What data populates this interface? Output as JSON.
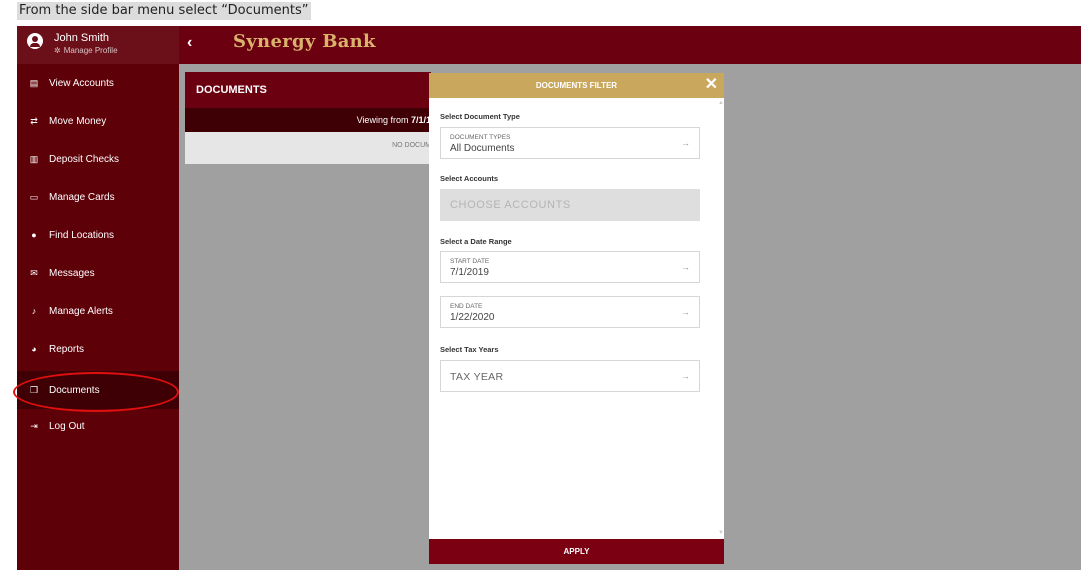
{
  "caption": "From the side bar menu select “Documents”",
  "profile": {
    "name": "John Smith",
    "manage": "Manage Profile"
  },
  "topbar": {
    "back": "‹",
    "brand": "Synergy Bank"
  },
  "sidebar": {
    "items": [
      {
        "label": "View Accounts",
        "icon": "accounts-icon"
      },
      {
        "label": "Move Money",
        "icon": "transfer-icon"
      },
      {
        "label": "Deposit Checks",
        "icon": "bank-icon"
      },
      {
        "label": "Manage Cards",
        "icon": "card-icon"
      },
      {
        "label": "Find Locations",
        "icon": "location-pin-icon"
      },
      {
        "label": "Messages",
        "icon": "envelope-icon"
      },
      {
        "label": "Manage Alerts",
        "icon": "bell-icon"
      },
      {
        "label": "Reports",
        "icon": "chart-icon"
      },
      {
        "label": "Documents",
        "icon": "document-icon",
        "active": true
      },
      {
        "label": "Log Out",
        "icon": "logout-icon"
      }
    ]
  },
  "documents": {
    "title": "DOCUMENTS",
    "viewing_prefix": "Viewing from",
    "viewing_date": "7/1/1",
    "empty": "NO DOCUM"
  },
  "filter": {
    "title": "DOCUMENTS FILTER",
    "close": "✕",
    "doc_type_label": "Select Document Type",
    "doc_type_small": "DOCUMENT TYPES",
    "doc_type_value": "All Documents",
    "accounts_label": "Select Accounts",
    "accounts_placeholder": "CHOOSE ACCOUNTS",
    "date_range_label": "Select a Date Range",
    "start_small": "START DATE",
    "start_value": "7/1/2019",
    "end_small": "END DATE",
    "end_value": "1/22/2020",
    "tax_label": "Select Tax Years",
    "tax_placeholder": "TAX YEAR",
    "apply": "APPLY"
  }
}
